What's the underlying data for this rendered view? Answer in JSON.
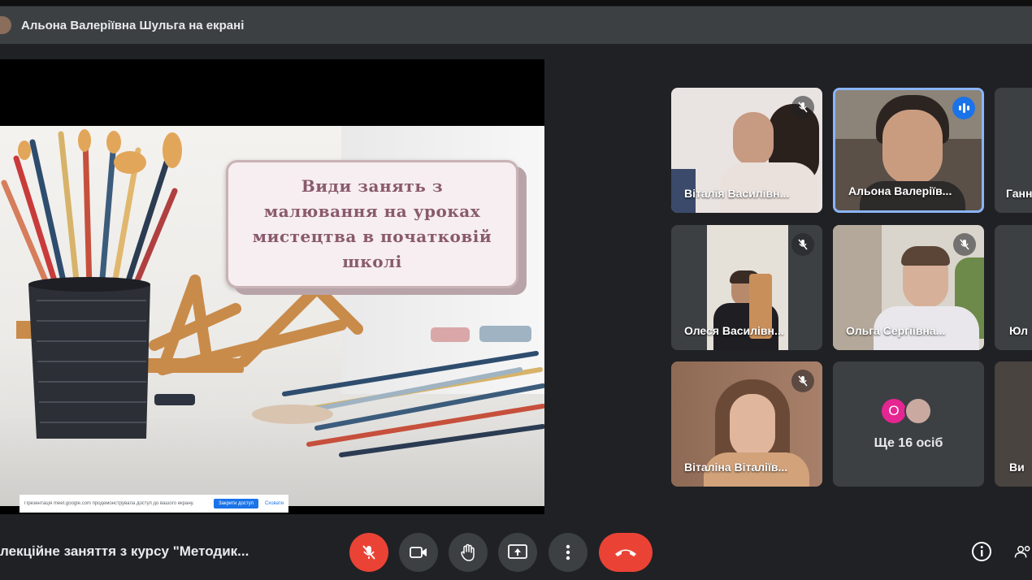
{
  "presenter": {
    "banner": "Альона Валеріївна Шульга на екрані"
  },
  "slide": {
    "title_lines": [
      "Види занять з",
      "малювання на уроках",
      "мистецтва в початковій",
      "школі"
    ]
  },
  "share_notice": {
    "text": "Презентація meet.google.com продемонструвала доступ до вашого екрану.",
    "stop_label": "Закрити доступ",
    "hide_label": "Сховати"
  },
  "participants": [
    {
      "name": "Віталія Василівн...",
      "mic": "off"
    },
    {
      "name": "Альона Валеріїв...",
      "mic": "speaking"
    },
    {
      "name": "Ганн",
      "mic": "none"
    },
    {
      "name": "Олеся Василівн...",
      "mic": "off"
    },
    {
      "name": "Ольга Сергіївна...",
      "mic": "off"
    },
    {
      "name": "Юл",
      "mic": "none"
    },
    {
      "name": "Віталіна Віталіїв...",
      "mic": "off"
    },
    {
      "name": "Ви",
      "mic": "none"
    }
  ],
  "more_tile": {
    "avatar_letter": "О",
    "label": "Ще 16 осіб"
  },
  "meeting": {
    "title": "лекційне заняття з курсу \"Методик..."
  },
  "colors": {
    "accent": "#1a73e8",
    "danger": "#ea4335",
    "control_bg": "#3c4043",
    "bg": "#202124"
  },
  "controls": [
    "mic-off-icon",
    "camera-icon",
    "raise-hand-icon",
    "present-screen-icon",
    "more-options-icon",
    "leave-call-icon"
  ],
  "right_controls": [
    "info-icon",
    "people-icon"
  ]
}
